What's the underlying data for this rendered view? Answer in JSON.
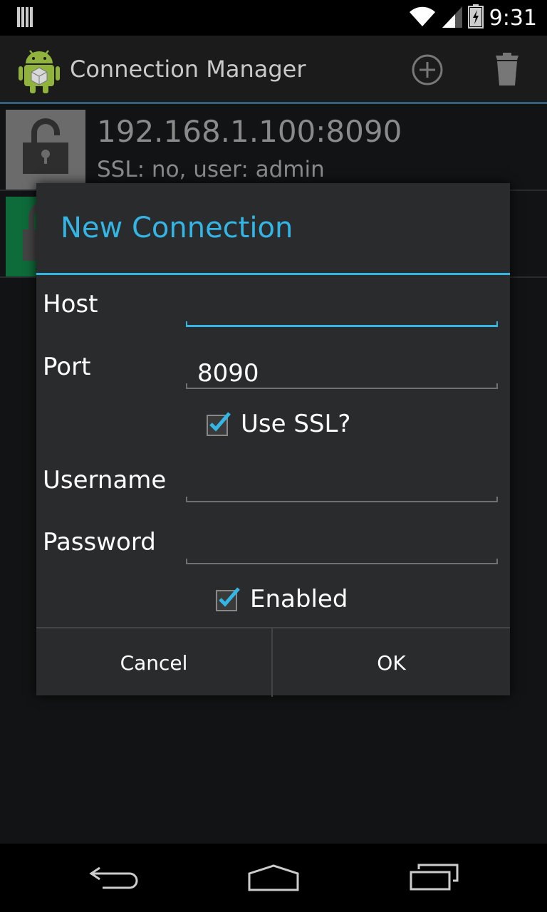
{
  "status_bar": {
    "time": "9:31"
  },
  "action_bar": {
    "title": "Connection Manager",
    "add_icon": "add-circle-icon",
    "delete_icon": "trash-icon"
  },
  "connections": [
    {
      "title": "192.168.1.100:8090",
      "subtitle": "SSL: no, user: admin",
      "icon": "unlocked-padlock-icon"
    },
    {
      "title": "",
      "subtitle": "",
      "icon": "locked-padlock-icon"
    }
  ],
  "dialog": {
    "title": "New Connection",
    "host": {
      "label": "Host",
      "value": ""
    },
    "port": {
      "label": "Port",
      "value": "8090"
    },
    "use_ssl": {
      "label": "Use SSL?",
      "checked": true
    },
    "username": {
      "label": "Username",
      "value": ""
    },
    "password": {
      "label": "Password",
      "value": ""
    },
    "enabled": {
      "label": "Enabled",
      "checked": true
    },
    "cancel_label": "Cancel",
    "ok_label": "OK"
  },
  "colors": {
    "accent": "#33b5e5",
    "dialog_bg": "#2a2b2c",
    "actionbar_bg": "#1b1b1b"
  }
}
